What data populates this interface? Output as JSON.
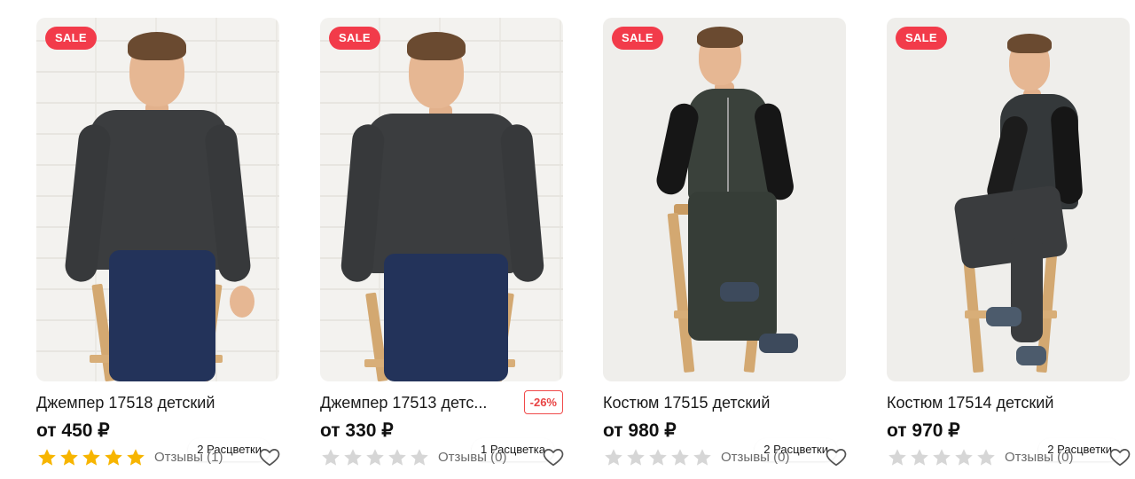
{
  "colors": {
    "sale_badge": "#f23b4a",
    "discount_border": "#f04a4a",
    "star_filled": "#f7b500",
    "star_empty": "#d6d6d6"
  },
  "products": [
    {
      "sale_badge": "SALE",
      "colorways": "2 Расцветки",
      "title": "Джемпер 17518 детский",
      "discount": "",
      "price": "от 450 ₽",
      "rating": 5,
      "reviews": "Отзывы (1)",
      "favorite_icon": "heart-outline-icon"
    },
    {
      "sale_badge": "SALE",
      "colorways": "1 Расцветка",
      "title": "Джемпер 17513 детс...",
      "discount": "-26%",
      "price": "от 330 ₽",
      "rating": 0,
      "reviews": "Отзывы (0)",
      "favorite_icon": "heart-outline-icon"
    },
    {
      "sale_badge": "SALE",
      "colorways": "2 Расцветки",
      "title": "Костюм 17515 детский",
      "discount": "",
      "price": "от 980 ₽",
      "rating": 0,
      "reviews": "Отзывы (0)",
      "favorite_icon": "heart-outline-icon"
    },
    {
      "sale_badge": "SALE",
      "colorways": "2 Расцветки",
      "title": "Костюм 17514 детский",
      "discount": "",
      "price": "от 970 ₽",
      "rating": 0,
      "reviews": "Отзывы (0)",
      "favorite_icon": "heart-outline-icon"
    }
  ]
}
